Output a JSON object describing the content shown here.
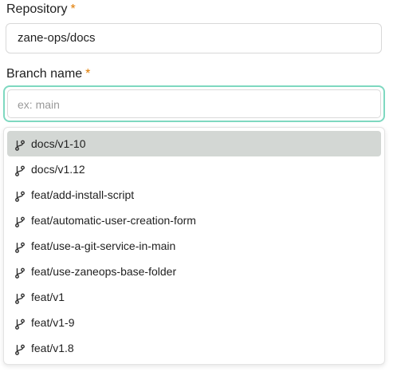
{
  "form": {
    "repository": {
      "label": "Repository",
      "required_mark": "*",
      "value": "zane-ops/docs"
    },
    "branch": {
      "label": "Branch name",
      "required_mark": "*",
      "placeholder": "ex: main",
      "value": ""
    }
  },
  "dropdown": {
    "highlighted_index": 0,
    "options": [
      {
        "label": "docs/v1-10",
        "icon": "git-branch-icon"
      },
      {
        "label": "docs/v1.12",
        "icon": "git-branch-icon"
      },
      {
        "label": "feat/add-install-script",
        "icon": "git-branch-icon"
      },
      {
        "label": "feat/automatic-user-creation-form",
        "icon": "git-branch-icon"
      },
      {
        "label": "feat/use-a-git-service-in-main",
        "icon": "git-branch-icon"
      },
      {
        "label": "feat/use-zaneops-base-folder",
        "icon": "git-branch-icon"
      },
      {
        "label": "feat/v1",
        "icon": "git-branch-icon"
      },
      {
        "label": "feat/v1-9",
        "icon": "git-branch-icon"
      },
      {
        "label": "feat/v1.8",
        "icon": "git-branch-icon"
      }
    ]
  },
  "colors": {
    "required": "#e07b00",
    "focus_ring": "#7ed8c0",
    "highlight": "#d3d7d4"
  }
}
